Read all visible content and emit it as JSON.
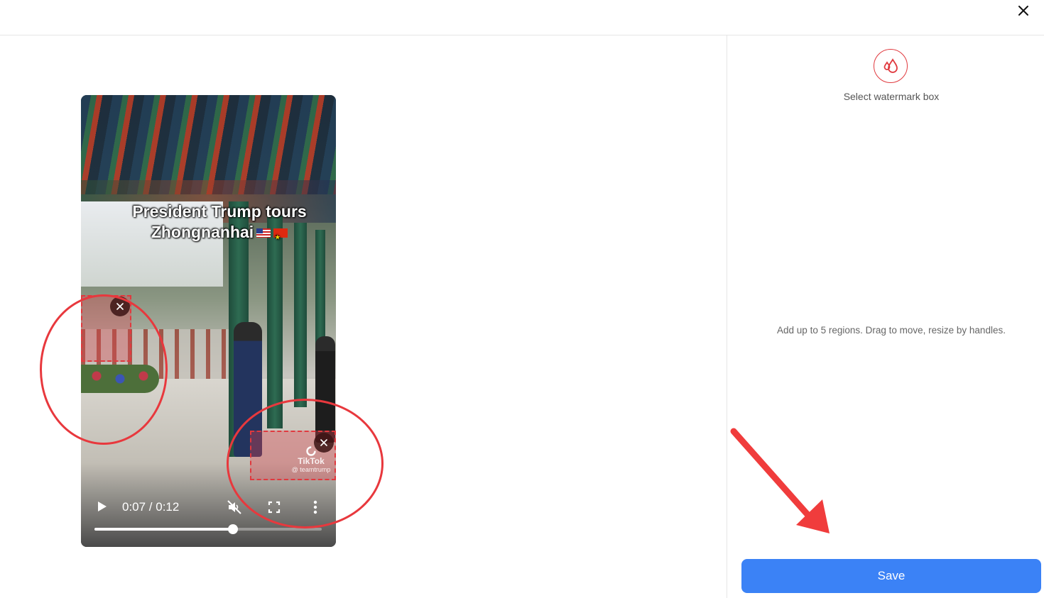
{
  "header": {
    "close_icon": "close-icon"
  },
  "video": {
    "caption_line1": "President Trump tours",
    "caption_line2": "Zhongnanhai",
    "current_time": "0:07",
    "duration": "0:12",
    "time_text": "0:07 / 0:12",
    "progress_fraction": 0.61,
    "watermark_brand": "TikTok",
    "watermark_handle": "@ teamtrump",
    "muted": true
  },
  "sidebar": {
    "watermark_icon": "watermark-drop-icon",
    "select_label": "Select watermark box",
    "hint": "Add up to 5 regions. Drag to move, resize by handles.",
    "save_label": "Save"
  },
  "colors": {
    "accent": "#3b82f6",
    "annotation": "#e8383d",
    "region": "#e0393e"
  }
}
